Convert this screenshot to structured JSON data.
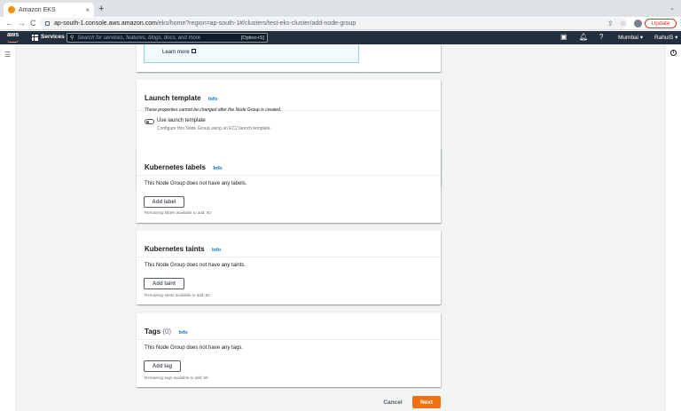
{
  "browser": {
    "tab_title": "Amazon EKS",
    "tab_close": "×",
    "new_tab": "+",
    "url_host": "ap-south-1.console.aws.amazon.com",
    "url_path": "/eks/home?region=ap-south-1#/clusters/test-eks-cluster/add-node-group",
    "update_label": "Update",
    "back": "←",
    "forward": "→",
    "reload": "C"
  },
  "aws_nav": {
    "logo": "aws",
    "services_label": "Services",
    "search_placeholder": "Search for services, features, blogs, docs, and more",
    "search_shortcut": "[Option+S]",
    "region_label": "Mumbai ▾",
    "user_label": "RahulS ▾"
  },
  "partial_card": {
    "learn_more": "Learn more"
  },
  "launch_template": {
    "title": "Launch template",
    "info": "Info",
    "description": "These properties cannot be changed after the Node Group is created.",
    "toggle_label": "Use launch template",
    "toggle_state": "off",
    "toggle_description": "Configure this Node Group using an EC2 launch template."
  },
  "labels": {
    "title": "Kubernetes labels",
    "info": "Info",
    "empty_text": "This Node Group does not have any labels.",
    "button": "Add label",
    "remaining": "Remaining labels available to add: 50"
  },
  "taints": {
    "title": "Kubernetes taints",
    "info": "Info",
    "empty_text": "This Node Group does not have any taints.",
    "button": "Add taint",
    "remaining": "Remaining taints available to add: 50"
  },
  "tags": {
    "title": "Tags",
    "count": "(0)",
    "info": "Info",
    "empty_text": "This Node Group does not have any tags.",
    "button": "Add tag",
    "remaining": "Remaining tags available to add: 50"
  },
  "footer": {
    "cancel": "Cancel",
    "next": "Next"
  },
  "colors": {
    "aws_nav_bg": "#232f3e",
    "primary_button": "#ec7211",
    "link": "#0073bb",
    "update_red": "#d93025"
  }
}
